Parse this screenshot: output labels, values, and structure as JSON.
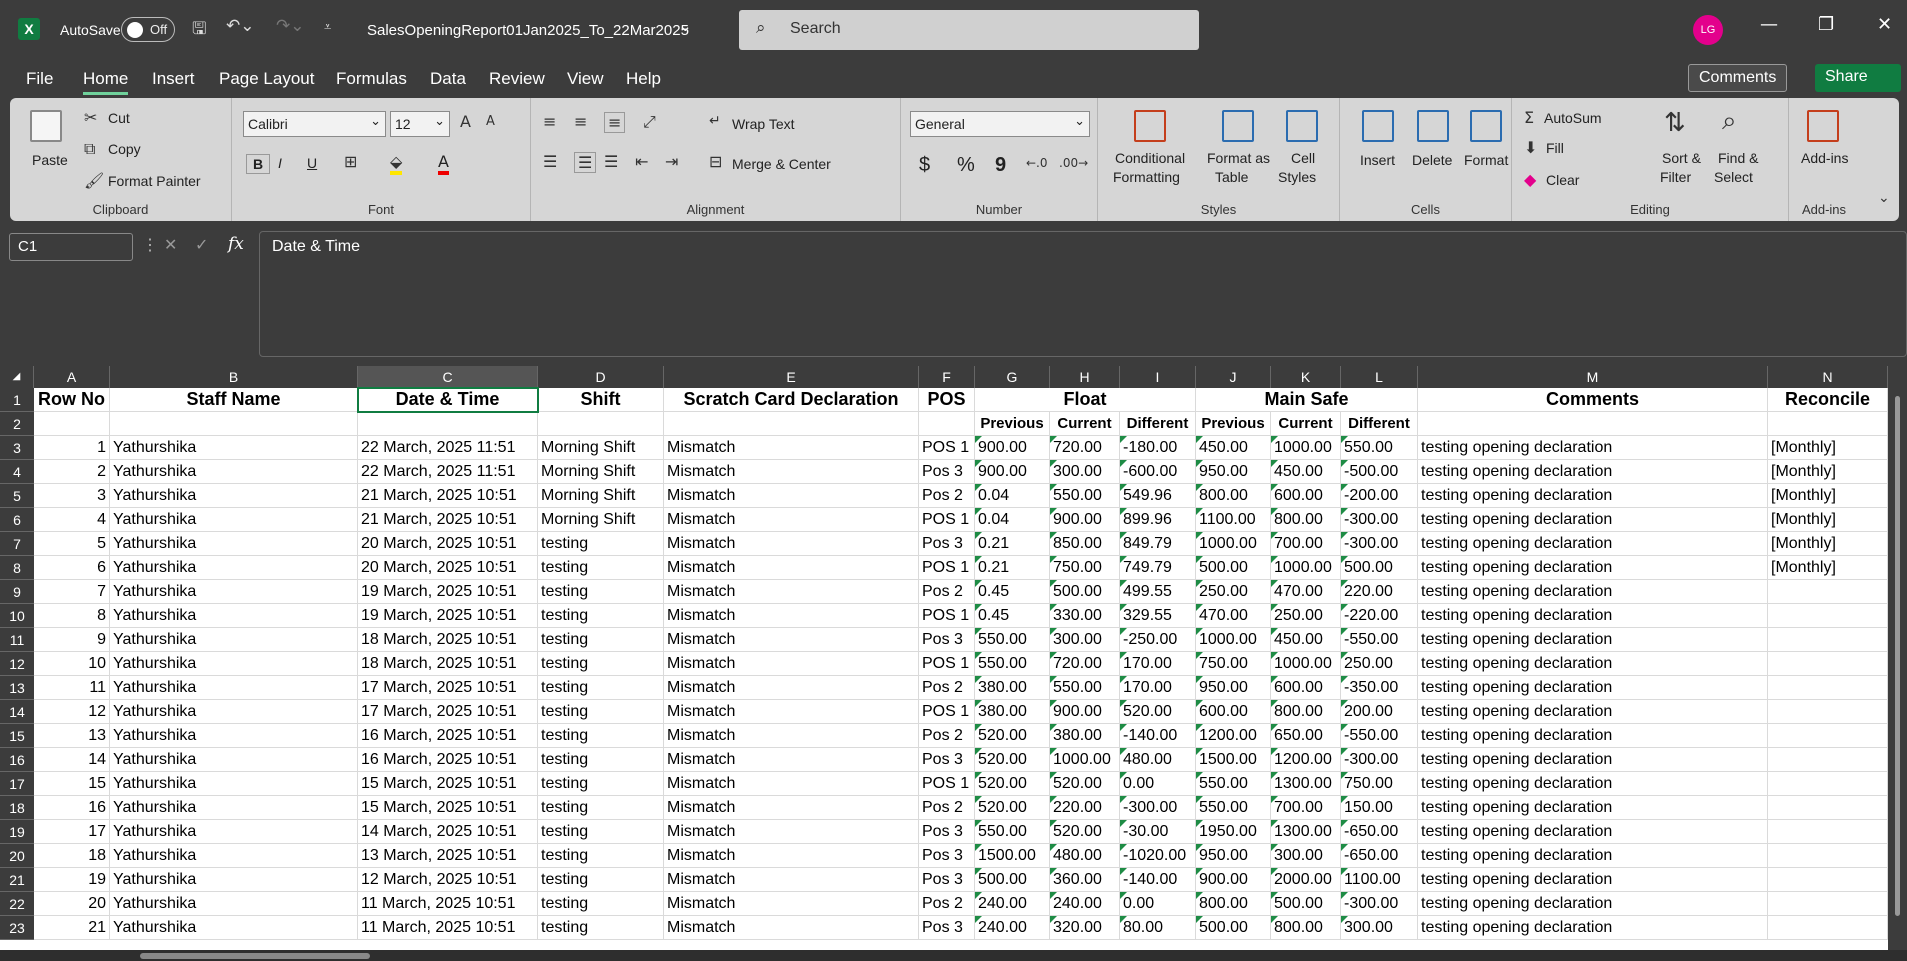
{
  "titlebar": {
    "app_letter": "X",
    "autosave": "AutoSave",
    "autosave_state": "Off",
    "file_name": "SalesOpeningReport01Jan2025_To_22Mar2025",
    "search_placeholder": "Search",
    "avatar": "LG"
  },
  "menu": {
    "items": [
      "File",
      "Home",
      "Insert",
      "Page Layout",
      "Formulas",
      "Data",
      "Review",
      "View",
      "Help"
    ],
    "active": "Home",
    "comments": "Comments",
    "share": "Share"
  },
  "ribbon": {
    "clipboard": {
      "label": "Clipboard",
      "paste": "Paste",
      "cut": "Cut",
      "copy": "Copy",
      "format_painter": "Format Painter"
    },
    "font": {
      "label": "Font",
      "name": "Calibri",
      "size": "12",
      "bold": "B",
      "italic": "I",
      "underline": "U"
    },
    "alignment": {
      "label": "Alignment",
      "wrap": "Wrap Text",
      "merge": "Merge & Center"
    },
    "number": {
      "label": "Number",
      "format": "General",
      "currency": "$",
      "percent": "%",
      "comma": "9"
    },
    "styles": {
      "label": "Styles",
      "conditional": "Conditional",
      "conditional2": "Formatting",
      "format_table": "Format as",
      "format_table2": "Table",
      "cell_styles": "Cell",
      "cell_styles2": "Styles"
    },
    "cells": {
      "label": "Cells",
      "insert": "Insert",
      "delete": "Delete",
      "format": "Format"
    },
    "editing": {
      "label": "Editing",
      "autosum": "AutoSum",
      "fill": "Fill",
      "clear": "Clear",
      "sort": "Sort &",
      "sort2": "Filter",
      "find": "Find &",
      "find2": "Select"
    },
    "addins": {
      "label": "Add-ins",
      "name": "Add-ins"
    }
  },
  "formula": {
    "name_box": "C1",
    "content": "Date & Time"
  },
  "columns": [
    "A",
    "B",
    "C",
    "D",
    "E",
    "F",
    "G",
    "H",
    "I",
    "J",
    "K",
    "L",
    "M",
    "N"
  ],
  "header1": {
    "A": "Row No",
    "B": "Staff Name",
    "C": "Date & Time",
    "D": "Shift",
    "E": "Scratch Card Declaration",
    "F": "POS",
    "float": "Float",
    "safe": "Main Safe",
    "M": "Comments",
    "N": "Reconcile"
  },
  "header2": [
    "Previous",
    "Current",
    "Different",
    "Previous",
    "Current",
    "Different"
  ],
  "rows": [
    [
      "1",
      "Yathurshika",
      "22 March, 2025 11:51",
      "Morning Shift",
      "Mismatch",
      "POS 1",
      "900.00",
      "720.00",
      "-180.00",
      "450.00",
      "1000.00",
      "550.00",
      "testing opening declaration",
      "[Monthly]"
    ],
    [
      "2",
      "Yathurshika",
      "22 March, 2025 11:51",
      "Morning Shift",
      "Mismatch",
      "Pos 3",
      "900.00",
      "300.00",
      "-600.00",
      "950.00",
      "450.00",
      "-500.00",
      "testing opening declaration",
      "[Monthly]"
    ],
    [
      "3",
      "Yathurshika",
      "21 March, 2025 10:51",
      "Morning Shift",
      "Mismatch",
      "Pos 2",
      "0.04",
      "550.00",
      "549.96",
      "800.00",
      "600.00",
      "-200.00",
      "testing opening declaration",
      "[Monthly]"
    ],
    [
      "4",
      "Yathurshika",
      "21 March, 2025 10:51",
      "Morning Shift",
      "Mismatch",
      "POS 1",
      "0.04",
      "900.00",
      "899.96",
      "1100.00",
      "800.00",
      "-300.00",
      "testing opening declaration",
      "[Monthly]"
    ],
    [
      "5",
      "Yathurshika",
      "20 March, 2025 10:51",
      "testing",
      "Mismatch",
      "Pos 3",
      "0.21",
      "850.00",
      "849.79",
      "1000.00",
      "700.00",
      "-300.00",
      "testing opening declaration",
      "[Monthly]"
    ],
    [
      "6",
      "Yathurshika",
      "20 March, 2025 10:51",
      "testing",
      "Mismatch",
      "POS 1",
      "0.21",
      "750.00",
      "749.79",
      "500.00",
      "1000.00",
      "500.00",
      "testing opening declaration",
      "[Monthly]"
    ],
    [
      "7",
      "Yathurshika",
      "19 March, 2025 10:51",
      "testing",
      "Mismatch",
      "Pos 2",
      "0.45",
      "500.00",
      "499.55",
      "250.00",
      "470.00",
      "220.00",
      "testing opening declaration",
      ""
    ],
    [
      "8",
      "Yathurshika",
      "19 March, 2025 10:51",
      "testing",
      "Mismatch",
      "POS 1",
      "0.45",
      "330.00",
      "329.55",
      "470.00",
      "250.00",
      "-220.00",
      "testing opening declaration",
      ""
    ],
    [
      "9",
      "Yathurshika",
      "18 March, 2025 10:51",
      "testing",
      "Mismatch",
      "Pos 3",
      "550.00",
      "300.00",
      "-250.00",
      "1000.00",
      "450.00",
      "-550.00",
      "testing opening declaration",
      ""
    ],
    [
      "10",
      "Yathurshika",
      "18 March, 2025 10:51",
      "testing",
      "Mismatch",
      "POS 1",
      "550.00",
      "720.00",
      "170.00",
      "750.00",
      "1000.00",
      "250.00",
      "testing opening declaration",
      ""
    ],
    [
      "11",
      "Yathurshika",
      "17 March, 2025 10:51",
      "testing",
      "Mismatch",
      "Pos 2",
      "380.00",
      "550.00",
      "170.00",
      "950.00",
      "600.00",
      "-350.00",
      "testing opening declaration",
      ""
    ],
    [
      "12",
      "Yathurshika",
      "17 March, 2025 10:51",
      "testing",
      "Mismatch",
      "POS 1",
      "380.00",
      "900.00",
      "520.00",
      "600.00",
      "800.00",
      "200.00",
      "testing opening declaration",
      ""
    ],
    [
      "13",
      "Yathurshika",
      "16 March, 2025 10:51",
      "testing",
      "Mismatch",
      "Pos 2",
      "520.00",
      "380.00",
      "-140.00",
      "1200.00",
      "650.00",
      "-550.00",
      "testing opening declaration",
      ""
    ],
    [
      "14",
      "Yathurshika",
      "16 March, 2025 10:51",
      "testing",
      "Mismatch",
      "Pos 3",
      "520.00",
      "1000.00",
      "480.00",
      "1500.00",
      "1200.00",
      "-300.00",
      "testing opening declaration",
      ""
    ],
    [
      "15",
      "Yathurshika",
      "15 March, 2025 10:51",
      "testing",
      "Mismatch",
      "POS 1",
      "520.00",
      "520.00",
      "0.00",
      "550.00",
      "1300.00",
      "750.00",
      "testing opening declaration",
      ""
    ],
    [
      "16",
      "Yathurshika",
      "15 March, 2025 10:51",
      "testing",
      "Mismatch",
      "Pos 2",
      "520.00",
      "220.00",
      "-300.00",
      "550.00",
      "700.00",
      "150.00",
      "testing opening declaration",
      ""
    ],
    [
      "17",
      "Yathurshika",
      "14 March, 2025 10:51",
      "testing",
      "Mismatch",
      "Pos 3",
      "550.00",
      "520.00",
      "-30.00",
      "1950.00",
      "1300.00",
      "-650.00",
      "testing opening declaration",
      ""
    ],
    [
      "18",
      "Yathurshika",
      "13 March, 2025 10:51",
      "testing",
      "Mismatch",
      "Pos 3",
      "1500.00",
      "480.00",
      "-1020.00",
      "950.00",
      "300.00",
      "-650.00",
      "testing opening declaration",
      ""
    ],
    [
      "19",
      "Yathurshika",
      "12 March, 2025 10:51",
      "testing",
      "Mismatch",
      "Pos 3",
      "500.00",
      "360.00",
      "-140.00",
      "900.00",
      "2000.00",
      "1100.00",
      "testing opening declaration",
      ""
    ],
    [
      "20",
      "Yathurshika",
      "11 March, 2025 10:51",
      "testing",
      "Mismatch",
      "Pos 2",
      "240.00",
      "240.00",
      "0.00",
      "800.00",
      "500.00",
      "-300.00",
      "testing opening declaration",
      ""
    ],
    [
      "21",
      "Yathurshika",
      "11 March, 2025 10:51",
      "testing",
      "Mismatch",
      "Pos 3",
      "240.00",
      "320.00",
      "80.00",
      "500.00",
      "800.00",
      "300.00",
      "testing opening declaration",
      ""
    ]
  ]
}
